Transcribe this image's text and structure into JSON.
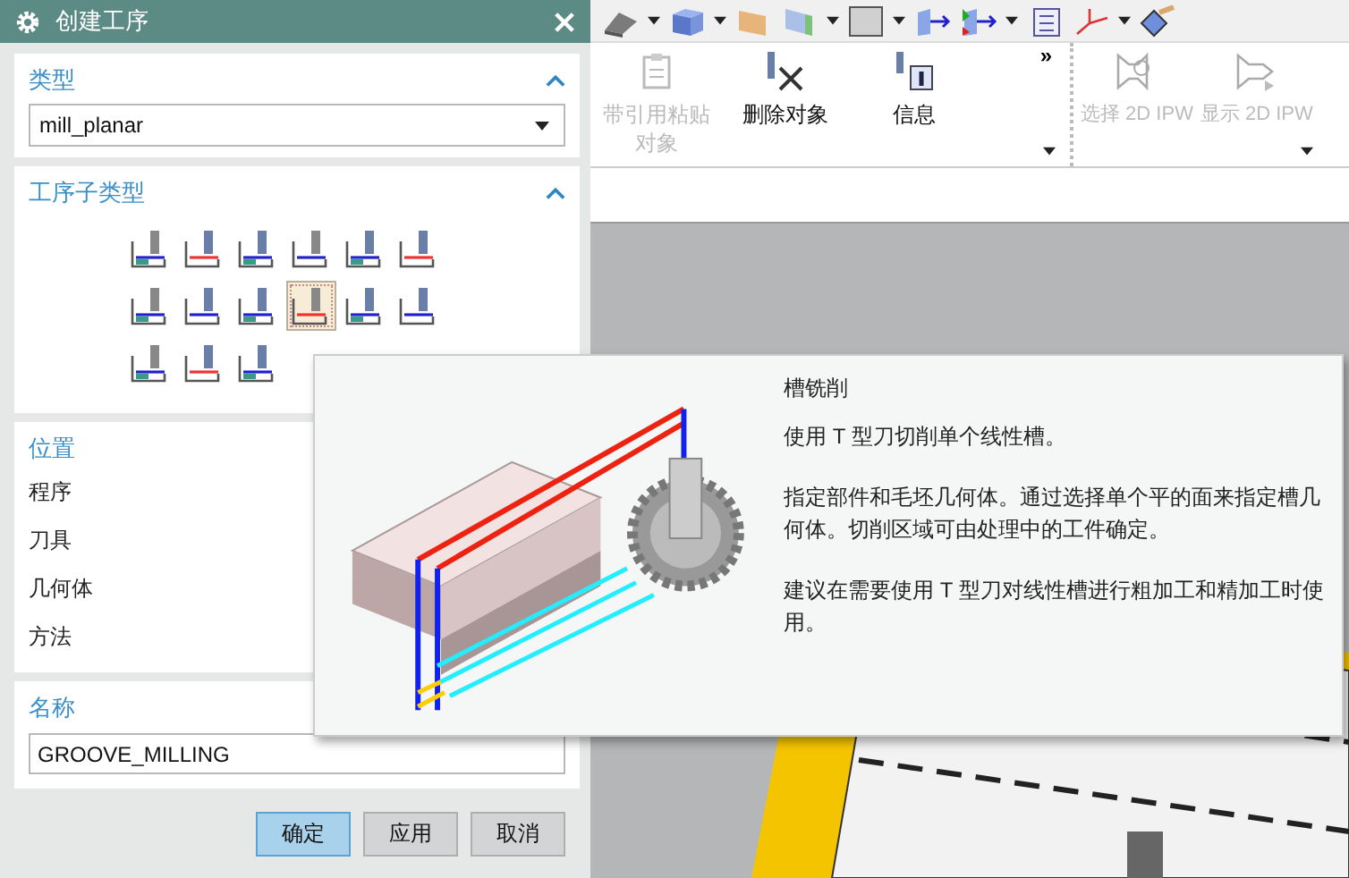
{
  "dialog": {
    "title": "创建工序",
    "type_section": {
      "label": "类型",
      "expanded": true,
      "value": "mill_planar"
    },
    "subtype_section": {
      "label": "工序子类型",
      "expanded": true,
      "items": [
        {
          "selected": false
        },
        {
          "selected": false
        },
        {
          "selected": false
        },
        {
          "selected": false
        },
        {
          "selected": false
        },
        {
          "selected": false
        },
        {
          "selected": false
        },
        {
          "selected": false
        },
        {
          "selected": false
        },
        {
          "selected": true
        },
        {
          "selected": false
        },
        {
          "selected": false
        },
        {
          "selected": false
        },
        {
          "selected": false
        },
        {
          "selected": false
        }
      ]
    },
    "location_section": {
      "label": "位置",
      "fields": [
        {
          "label": "程序"
        },
        {
          "label": "刀具"
        },
        {
          "label": "几何体"
        },
        {
          "label": "方法"
        }
      ]
    },
    "name_section": {
      "label": "名称",
      "value": "GROOVE_MILLING"
    },
    "buttons": [
      {
        "label": "确定",
        "default": true
      },
      {
        "label": "应用",
        "default": false
      },
      {
        "label": "取消",
        "default": false
      }
    ]
  },
  "ribbon": {
    "groups": [
      {
        "items": [
          {
            "label": "带引用粘贴对象",
            "disabled": true
          },
          {
            "label": "删除对象",
            "disabled": false
          },
          {
            "label": "信息",
            "disabled": false
          }
        ],
        "overflow": "»"
      },
      {
        "items": [
          {
            "label": "选择 2D IPW",
            "disabled": true
          },
          {
            "label": "显示 2D IPW",
            "disabled": true
          }
        ]
      }
    ]
  },
  "tooltip": {
    "title": "槽铣削",
    "paragraphs": [
      "使用 T 型刀切削单个线性槽。",
      "指定部件和毛坯几何体。通过选择单个平的面来指定槽几何体。切削区域可由处理中的工件确定。",
      "建议在需要使用 T 型刀对线性槽进行粗加工和精加工时使用。"
    ]
  }
}
